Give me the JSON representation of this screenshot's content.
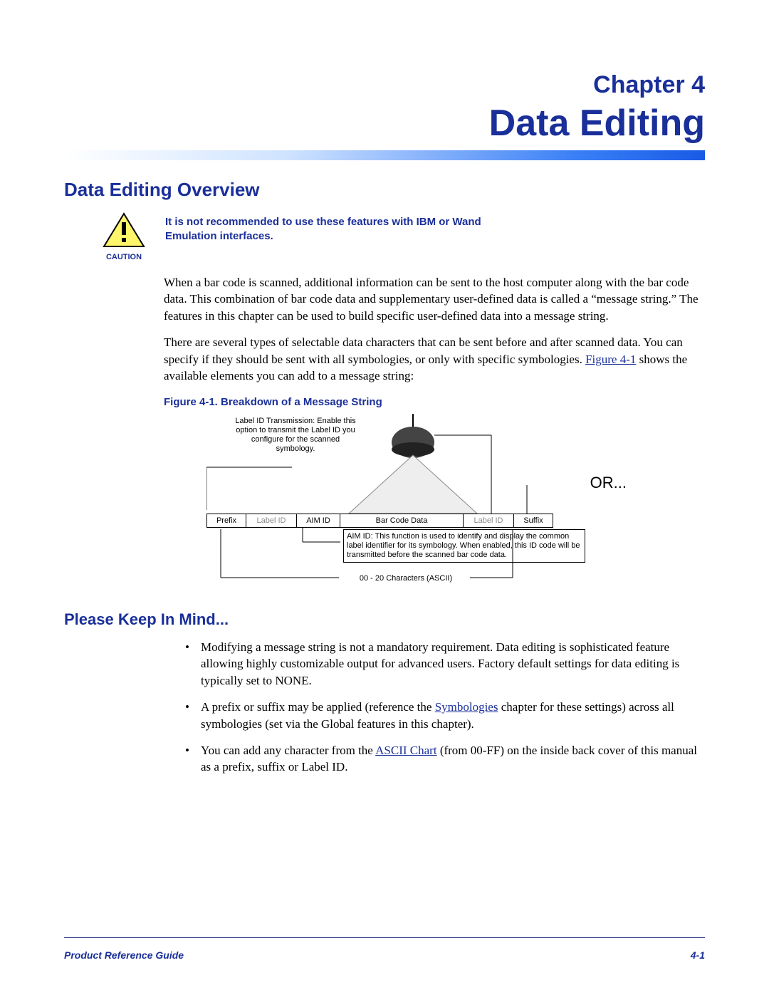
{
  "chapter": {
    "label": "Chapter 4",
    "title": "Data Editing"
  },
  "section1": {
    "heading": "Data Editing Overview",
    "caution_label": "CAUTION",
    "caution_text": "It is not recommended to use these features with IBM or Wand Emulation interfaces.",
    "para1": "When a bar code is scanned, additional information can be sent to the host computer along with the bar code data.  This combination of bar code data and supplementary user-defined data is called a “message string.”  The features in this chapter can be used to build specific user-defined data into a message string.",
    "para2a": "There are several types of selectable data characters that can be sent before and after scanned data. You can specify if they should be sent with all symbologies, or only with specific symbologies.  ",
    "para2_link": "Figure 4-1",
    "para2b": " shows the available elements you can add to a message string:",
    "figure_caption": "Figure 4-1. Breakdown of a Message String"
  },
  "figure": {
    "label_tx": "Label ID Transmission: Enable this option to transmit the Label ID you configure for the scanned symbology.",
    "or": "OR...",
    "segments": [
      "Prefix",
      "Label ID",
      "AIM ID",
      "Bar Code Data",
      "Label ID",
      "Suffix"
    ],
    "aim_note": "AIM ID: This function is used to identify and display the common label identifier for its symbology. When enabled, this ID code will be transmitted before the scanned bar code data.",
    "char_note": "00 - 20 Characters (ASCII)"
  },
  "section2": {
    "heading": "Please Keep In Mind...",
    "bullets": [
      {
        "pre": "Modifying a message string is not a mandatory requirement.  Data editing is sophisticated feature allowing highly customizable output for advanced users. Factory default settings for data editing is typically set to NONE."
      },
      {
        "pre": "A prefix or suffix may be applied (reference the ",
        "link": "Symbologies",
        "post": " chapter for these settings) across all symbologies (set via the Global features in this chapter)."
      },
      {
        "pre": "You can add any character from the ",
        "link": "ASCII Chart",
        "post": " (from 00-FF) on the inside back cover of this manual as a prefix, suffix or Label ID."
      }
    ]
  },
  "footer": {
    "left": "Product Reference Guide",
    "right": "4-1"
  }
}
